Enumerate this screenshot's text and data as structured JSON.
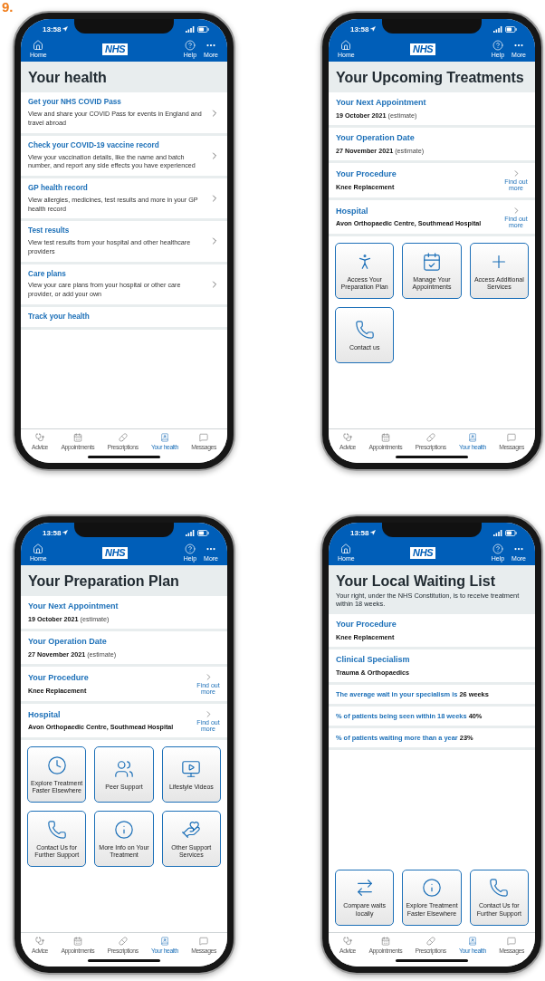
{
  "label": "9.",
  "phones": [
    {
      "time": "13:58",
      "home": "Home",
      "logo": "NHS",
      "help": "Help",
      "more": "More",
      "title": "Your health",
      "sections": [
        {
          "kind": "link",
          "heading": "Get your NHS COVID Pass",
          "text": "View and share your COVID Pass for events in England and travel abroad"
        },
        {
          "kind": "link",
          "heading": "Check your COVID-19 vaccine record",
          "text": "View your vaccination details, like the name and batch number, and report any side effects you have experienced"
        },
        {
          "kind": "link",
          "heading": "GP health record",
          "text": "View allergies, medicines, test results and more in your GP health record"
        },
        {
          "kind": "link",
          "heading": "Test results",
          "text": "View test results from your hospital and other healthcare providers"
        },
        {
          "kind": "link",
          "heading": "Care plans",
          "text": "View your care plans from your hospital or other care provider, or add your own"
        },
        {
          "kind": "cut",
          "heading": "Track your health"
        }
      ],
      "tabs": [
        {
          "label": "Advice",
          "selected": false
        },
        {
          "label": "Appointments",
          "selected": false
        },
        {
          "label": "Prescriptions",
          "selected": false
        },
        {
          "label": "Your health",
          "selected": true
        },
        {
          "label": "Messages",
          "selected": false
        }
      ]
    },
    {
      "time": "13:58",
      "home": "Home",
      "logo": "NHS",
      "help": "Help",
      "more": "More",
      "title": "Your Upcoming Treatments",
      "sections": [
        {
          "kind": "info",
          "heading": "Your Next Appointment",
          "value": "19 October 2021",
          "note": "(estimate)"
        },
        {
          "kind": "info",
          "heading": "Your Operation Date",
          "value": "27 November 2021",
          "note": "(estimate)"
        },
        {
          "kind": "more",
          "heading": "Your Procedure",
          "value": "Knee Replacement",
          "action": "Find out more"
        },
        {
          "kind": "more",
          "heading": "Hospital",
          "value": "Avon Orthopaedic Centre, Southmead Hospital",
          "action": "Find out more"
        }
      ],
      "tiles": [
        {
          "label": "Access Your Preparation Plan"
        },
        {
          "label": "Manage Your Appointments"
        },
        {
          "label": "Access Additional Services"
        },
        {
          "label": "Contact us"
        }
      ],
      "tabs": [
        {
          "label": "Advice",
          "selected": false
        },
        {
          "label": "Appointments",
          "selected": false
        },
        {
          "label": "Prescriptions",
          "selected": false
        },
        {
          "label": "Your health",
          "selected": true
        },
        {
          "label": "Messages",
          "selected": false
        }
      ]
    },
    {
      "time": "13:58",
      "home": "Home",
      "logo": "NHS",
      "help": "Help",
      "more": "More",
      "title": "Your Preparation Plan",
      "sections": [
        {
          "kind": "info",
          "heading": "Your Next Appointment",
          "value": "19 October 2021",
          "note": "(estimate)"
        },
        {
          "kind": "info",
          "heading": "Your Operation Date",
          "value": "27 November 2021",
          "note": "(estimate)"
        },
        {
          "kind": "more",
          "heading": "Your Procedure",
          "value": "Knee Replacement",
          "action": "Find out more"
        },
        {
          "kind": "more",
          "heading": "Hospital",
          "value": "Avon Orthopaedic Centre, Southmead Hospital",
          "action": "Find out more"
        }
      ],
      "tiles": [
        {
          "label": "Explore Treatment Faster Elsewhere"
        },
        {
          "label": "Peer Support"
        },
        {
          "label": "Lifestyle Videos"
        },
        {
          "label": "Contact Us for Further Support"
        },
        {
          "label": "More Info on Your Treatment"
        },
        {
          "label": "Other Support Services"
        }
      ],
      "tabs": [
        {
          "label": "Advice",
          "selected": false
        },
        {
          "label": "Appointments",
          "selected": false
        },
        {
          "label": "Prescriptions",
          "selected": false
        },
        {
          "label": "Your health",
          "selected": true
        },
        {
          "label": "Messages",
          "selected": false
        }
      ]
    },
    {
      "time": "13:58",
      "home": "Home",
      "logo": "NHS",
      "help": "Help",
      "more": "More",
      "title": "Your Local Waiting List",
      "subtitle": "Your right, under the NHS Constitution, is to receive treatment within 18 weeks.",
      "sections": [
        {
          "kind": "info",
          "heading": "Your Procedure",
          "value": "Knee Replacement"
        },
        {
          "kind": "info",
          "heading": "Clinical Specialism",
          "value": "Trauma & Orthopaedics"
        },
        {
          "kind": "stat",
          "text": "The average wait in your specialism is **26 weeks**"
        },
        {
          "kind": "stat",
          "text": "% of patients being seen within 18 weeks **40%**"
        },
        {
          "kind": "stat",
          "text": "% of patients waiting more than a year **23%**"
        }
      ],
      "tiles": [
        {
          "label": "Compare waits locally"
        },
        {
          "label": "Explore Treatment Faster Elsewhere"
        },
        {
          "label": "Contact Us for Further Support"
        }
      ],
      "tabs": [
        {
          "label": "Advice",
          "selected": false
        },
        {
          "label": "Appointments",
          "selected": false
        },
        {
          "label": "Prescriptions",
          "selected": false
        },
        {
          "label": "Your health",
          "selected": true
        },
        {
          "label": "Messages",
          "selected": false
        }
      ]
    }
  ]
}
